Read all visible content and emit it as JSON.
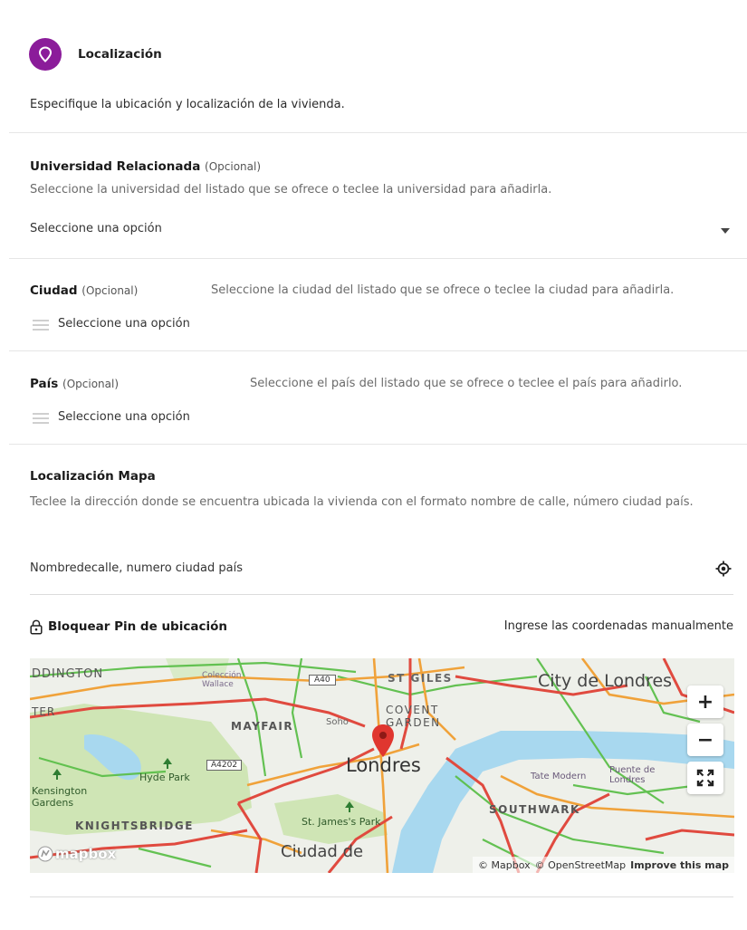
{
  "header": {
    "title": "Localización",
    "description": "Especifique la ubicación y localización de la vivienda."
  },
  "university": {
    "label": "Universidad Relacionada",
    "optional": "(Opcional)",
    "help": "Seleccione la universidad del listado que se ofrece o teclee la universidad para añadirla.",
    "placeholder": "Seleccione una opción"
  },
  "city": {
    "label": "Ciudad",
    "optional": "(Opcional)",
    "help": "Seleccione la ciudad del listado que se ofrece o teclee la ciudad para añadirla.",
    "placeholder": "Seleccione una opción"
  },
  "country": {
    "label": "País",
    "optional": "(Opcional)",
    "help": "Seleccione el país del listado que se ofrece o teclee el país para añadirlo.",
    "placeholder": "Seleccione una opción"
  },
  "map_section": {
    "label": "Localización Mapa",
    "help": "Teclee la dirección donde se encuentra ubicada la vivienda con el formato nombre de calle, número ciudad país.",
    "address_placeholder": "Nombredecalle, numero ciudad país",
    "lock_pin_label": "Bloquear Pin de ubicación",
    "manual_coords_link": "Ingrese las coordenadas manualmente"
  },
  "map": {
    "places": {
      "paddington": "DDINGTON",
      "wallace": "Colección Wallace",
      "a40": "A40",
      "st_giles": "ST GILES",
      "city": "City de Londres",
      "ter": "TER",
      "soho": "Soho",
      "covent": "COVENT GARDEN",
      "mayfair": "MAYFAIR",
      "a4202": "A4202",
      "londres": "Londres",
      "kensington": "Kensington Gardens",
      "hyde_park": "Hyde Park",
      "tate": "Tate Modern",
      "puente": "Puente de Londres",
      "southwark": "SOUTHWARK",
      "knightsbridge": "KNIGHTSBRIDGE",
      "st_james": "St. James's Park",
      "ciudad_de": "Ciudad de"
    },
    "zoom_in": "+",
    "zoom_out": "−",
    "logo": "mapbox",
    "attribution_mapbox": "© Mapbox",
    "attribution_osm": "© OpenStreetMap",
    "improve": "Improve this map",
    "colors": {
      "water": "#a8d8ef",
      "park": "#cfe5b5",
      "road_major": "#e04a3f",
      "road_medium": "#f0a23a",
      "road_minor": "#5cbf4a",
      "pin": "#e0362f"
    }
  },
  "colors": {
    "accent": "#8b1c9a"
  }
}
